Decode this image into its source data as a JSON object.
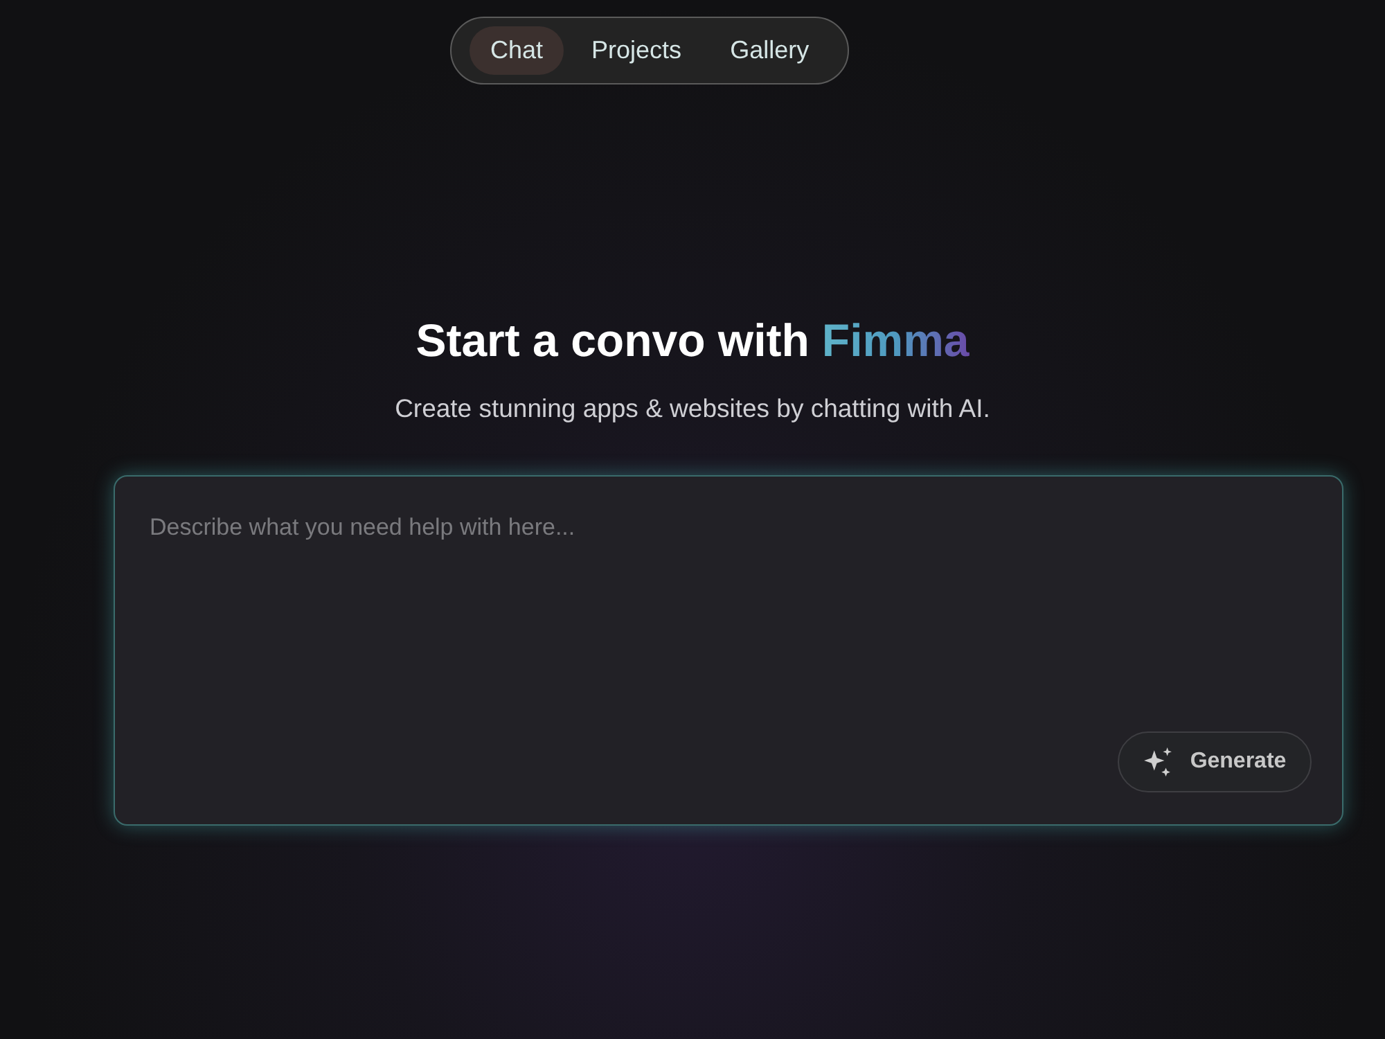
{
  "nav": {
    "tabs": [
      {
        "label": "Chat",
        "selected": true
      },
      {
        "label": "Projects",
        "selected": false
      },
      {
        "label": "Gallery",
        "selected": false
      }
    ]
  },
  "heading": {
    "text": "Start a convo with",
    "brand": "Fimma"
  },
  "subtitle": "Create stunning apps & websites by chatting with AI.",
  "prompt": {
    "placeholder": "Describe what you need help with here...",
    "button": "Generate"
  }
}
